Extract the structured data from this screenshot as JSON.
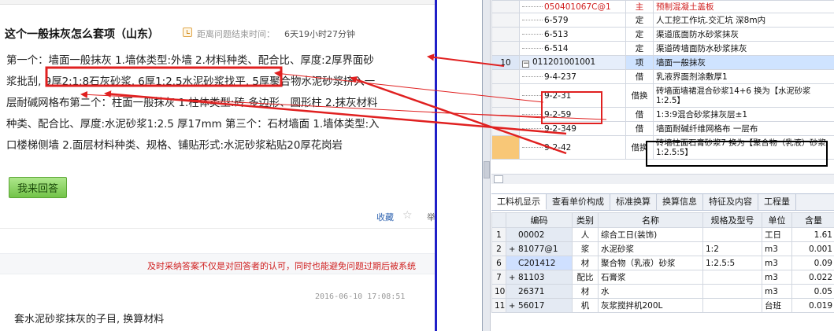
{
  "question": {
    "title": "这个一般抹灰怎么套项（山东）",
    "remain_label": "距离问题结束时间：",
    "remain_value": "6天19小时27分钟",
    "body_lines": [
      "第一个：墙面一般抹灰 1.墙体类型:外墙 2.材料种类、配合比、厚度:2厚界面砂",
      "浆批刮, 9厚2:1:8石灰砂浆, 6厚1:2.5水泥砂浆找平, 5厚聚合物水泥砂浆挤入一",
      "层耐碱网格布第二个：柱面一般抹灰 1.柱体类型:砖 多边形、圆形柱 2.抹灰材料",
      "种类、配合比、厚度:水泥砂浆1:2.5 厚17mm 第三个：石材墙面 1.墙体类型:入",
      "口楼梯侧墙 2.面层材料种类、规格、铺贴形式:水泥砂浆粘贴20厚花岗岩"
    ],
    "answer_button": "我来回答",
    "favorite": "收藏",
    "favorite_extra": "举"
  },
  "notice": "及时采纳答案不仅是对回答者的认可，同时也能避免问题过期后被系统",
  "answer": {
    "time": "2016-06-10 17:08:51",
    "text": "套水泥砂浆抹灰的子目, 换算材料"
  },
  "upper_rows": [
    {
      "no": "",
      "code": "050401067C@1",
      "type": "主",
      "name": "预制混凝土盖板",
      "style": "red"
    },
    {
      "no": "",
      "code": "6-579",
      "type": "定",
      "name": "人工挖工作坑.交汇坑 深8m内",
      "style": ""
    },
    {
      "no": "",
      "code": "6-513",
      "type": "定",
      "name": "渠道底面防水砂浆抹灰",
      "style": ""
    },
    {
      "no": "",
      "code": "6-514",
      "type": "定",
      "name": "渠道砖墙面防水砂浆抹灰",
      "style": ""
    },
    {
      "no": "10",
      "code": "011201001001",
      "type": "项",
      "name": "墙面一般抹灰",
      "style": "sel"
    },
    {
      "no": "",
      "code": "9-4-237",
      "type": "借",
      "name": "乳液界面剂涂敷厚1",
      "style": ""
    },
    {
      "no": "",
      "code": "9-2-31",
      "type": "借换",
      "name": "砖墙面墙裙混合砂浆14+6  换为【水泥砂浆1:2.5】",
      "style": "tall"
    },
    {
      "no": "",
      "code": "9-2-59",
      "type": "借",
      "name": "1:3:9混合砂浆抹灰层±1",
      "style": ""
    },
    {
      "no": "",
      "code": "9-2-349",
      "type": "借",
      "name": "墙面耐碱纤维网格布 一层布",
      "style": ""
    },
    {
      "no": "",
      "code": "9-2-42",
      "type": "借换",
      "name": "砖墙柱面石膏砂浆7  换为【聚合物（乳液）砂浆1:2.5:5】",
      "style": "tall orange"
    }
  ],
  "tabs": [
    "工料机显示",
    "查看单价构成",
    "标准换算",
    "换算信息",
    "特征及内容",
    "工程量"
  ],
  "lower_header": [
    "",
    "编码",
    "类别",
    "名称",
    "规格及型号",
    "单位",
    "含量"
  ],
  "lower_rows": [
    {
      "no": "1",
      "exp": "",
      "code": "00002",
      "cat": "人",
      "name": "综合工日(装饰)",
      "spec": "",
      "unit": "工日",
      "qty": "1.61"
    },
    {
      "no": "2",
      "exp": "+",
      "code": "81077@1",
      "cat": "浆",
      "name": "水泥砂浆",
      "spec": "1:2",
      "unit": "m3",
      "qty": "0.001"
    },
    {
      "no": "6",
      "exp": "",
      "code": "C201412",
      "cat": "材",
      "name": "聚合物（乳液）砂浆",
      "spec": "1:2.5:5",
      "unit": "m3",
      "qty": "0.09"
    },
    {
      "no": "7",
      "exp": "+",
      "code": "81103",
      "cat": "配比",
      "name": "石膏浆",
      "spec": "",
      "unit": "m3",
      "qty": "0.022"
    },
    {
      "no": "10",
      "exp": "",
      "code": "26371",
      "cat": "材",
      "name": "水",
      "spec": "",
      "unit": "m3",
      "qty": "0.05"
    },
    {
      "no": "11",
      "exp": "+",
      "code": "56017",
      "cat": "机",
      "name": "灰浆搅拌机200L",
      "spec": "",
      "unit": "台班",
      "qty": "0.019"
    }
  ],
  "colors": {
    "annotation": "#e02020",
    "divider": "#1f1fc8",
    "selected_row": "#cfe3ff",
    "orange_cell": "#f8c777",
    "button_green": "#72c348"
  }
}
